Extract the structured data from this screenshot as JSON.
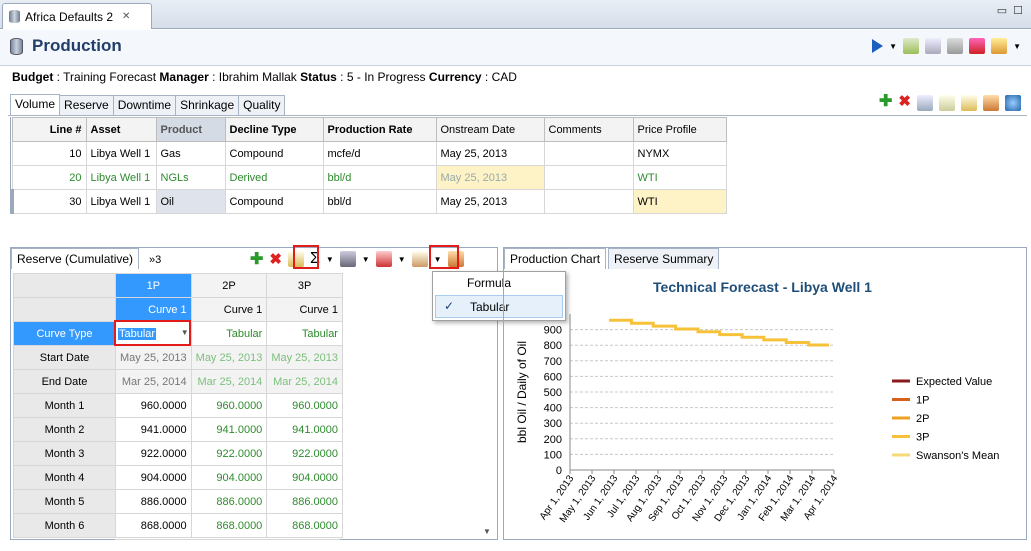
{
  "window": {
    "tab_title": "Africa Defaults 2",
    "close_glyph": "✕",
    "min_glyph": "▭",
    "max_glyph": "☐"
  },
  "header": {
    "title": "Production"
  },
  "info": {
    "budget_label": "Budget",
    "budget": "Training Forecast",
    "manager_label": "Manager",
    "manager": "Ibrahim Mallak",
    "status_label": "Status",
    "status": "5 - In Progress",
    "currency_label": "Currency",
    "currency": "CAD"
  },
  "subtabs": [
    "Volume",
    "Reserve",
    "Downtime",
    "Shrinkage",
    "Quality"
  ],
  "main_table": {
    "columns": [
      "Line #",
      "Asset",
      "Product",
      "Decline Type",
      "Production Rate",
      "Onstream Date",
      "Comments",
      "Price Profile"
    ],
    "rows": [
      [
        "10",
        "Libya Well 1",
        "Gas",
        "Compound",
        "mcfe/d",
        "May 25, 2013",
        "",
        "NYMX"
      ],
      [
        "20",
        "Libya Well 1",
        "NGLs",
        "Derived",
        "bbl/d",
        "May 25, 2013",
        "",
        "WTI"
      ],
      [
        "30",
        "Libya Well 1",
        "Oil",
        "Compound",
        "bbl/d",
        "May 25, 2013",
        "",
        "WTI"
      ]
    ]
  },
  "left_panel": {
    "tab": "Reserve (Cumulative)",
    "overflow": "»3",
    "sigma": "Σ"
  },
  "reserve_table": {
    "cases": [
      "1P",
      "2P",
      "3P"
    ],
    "curves": [
      "Curve 1",
      "Curve 1",
      "Curve 1"
    ],
    "curve_type_label": "Curve Type",
    "curve_type": [
      "Tabular",
      "Tabular",
      "Tabular"
    ],
    "start_label": "Start Date",
    "start": [
      "May 25, 2013",
      "May 25, 2013",
      "May 25, 2013"
    ],
    "end_label": "End Date",
    "end": [
      "Mar 25, 2014",
      "Mar 25, 2014",
      "Mar 25, 2014"
    ],
    "months": [
      {
        "label": "Month 1",
        "vals": [
          "960.0000",
          "960.0000",
          "960.0000"
        ]
      },
      {
        "label": "Month 2",
        "vals": [
          "941.0000",
          "941.0000",
          "941.0000"
        ]
      },
      {
        "label": "Month 3",
        "vals": [
          "922.0000",
          "922.0000",
          "922.0000"
        ]
      },
      {
        "label": "Month 4",
        "vals": [
          "904.0000",
          "904.0000",
          "904.0000"
        ]
      },
      {
        "label": "Month 5",
        "vals": [
          "886.0000",
          "886.0000",
          "886.0000"
        ]
      },
      {
        "label": "Month 6",
        "vals": [
          "868.0000",
          "868.0000",
          "868.0000"
        ]
      }
    ]
  },
  "dropdown_menu": {
    "items": [
      "Formula",
      "Tabular"
    ],
    "checked": "Tabular",
    "check_glyph": "✓"
  },
  "right_panel": {
    "tabs": [
      "Production Chart",
      "Reserve Summary"
    ]
  },
  "chart_data": {
    "type": "line",
    "title": "Technical Forecast - Libya Well 1",
    "ylabel": "bbl Oil / Daily of Oil",
    "xlabel": "",
    "ylim": [
      0,
      1000
    ],
    "yticks": [
      0,
      100,
      200,
      300,
      400,
      500,
      600,
      700,
      800,
      900
    ],
    "categories": [
      "Apr 1, 2013",
      "May 1, 2013",
      "Jun 1, 2013",
      "Jul 1, 2013",
      "Aug 1, 2013",
      "Sep 1, 2013",
      "Oct 1, 2013",
      "Nov 1, 2013",
      "Dec 1, 2013",
      "Jan 1, 2014",
      "Feb 1, 2014",
      "Mar 1, 2014",
      "Apr 1, 2014"
    ],
    "legend": [
      {
        "name": "Expected Value",
        "color": "#8b1a1a"
      },
      {
        "name": "1P",
        "color": "#d4621a"
      },
      {
        "name": "2P",
        "color": "#f0a020"
      },
      {
        "name": "3P",
        "color": "#f7c23a"
      },
      {
        "name": "Swanson's Mean",
        "color": "#f8d978"
      }
    ],
    "series": [
      {
        "name": "3P",
        "x": [
          "May 25, 2013",
          "Jun 25, 2013",
          "Jul 25, 2013",
          "Aug 25, 2013",
          "Sep 25, 2013",
          "Oct 25, 2013",
          "Nov 25, 2013",
          "Dec 25, 2013",
          "Jan 25, 2014",
          "Feb 25, 2014",
          "Mar 25, 2014"
        ],
        "values": [
          960,
          941,
          922,
          904,
          886,
          868,
          851,
          834,
          817,
          801,
          801
        ]
      }
    ],
    "legend_position": "right",
    "grid": true
  },
  "colors": {
    "accent": "#3399ff",
    "green_text": "#2e8b2e",
    "yellow_cell": "#fdf3c6",
    "red_highlight": "#e21b1b"
  }
}
